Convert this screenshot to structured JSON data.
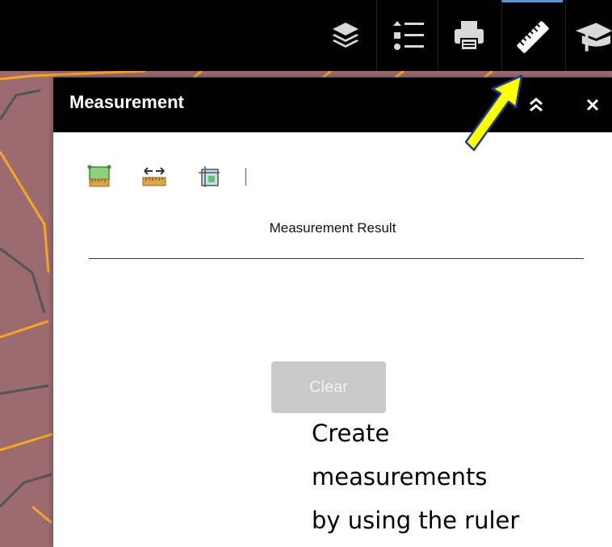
{
  "toolbar": {
    "tools": [
      {
        "icon": "layers-icon"
      },
      {
        "icon": "legend-list-icon"
      },
      {
        "icon": "print-icon"
      },
      {
        "icon": "ruler-icon",
        "active": true
      },
      {
        "icon": "graduation-cap-icon"
      }
    ],
    "accent_color": "#5b8fd6"
  },
  "panel": {
    "title": "Measurement",
    "tools": [
      {
        "icon": "area-measure-icon"
      },
      {
        "icon": "distance-measure-icon"
      },
      {
        "icon": "location-measure-icon"
      }
    ],
    "result_label": "Measurement Result",
    "clear_label": "Clear"
  },
  "annotation": {
    "lines": [
      "Create",
      "measurements",
      "by using the ruler"
    ],
    "arrow_color": "#ffff00"
  },
  "map": {
    "fill_color": "#9c6b70",
    "road_color": "#f5a623",
    "boundary_color": "#555555"
  }
}
